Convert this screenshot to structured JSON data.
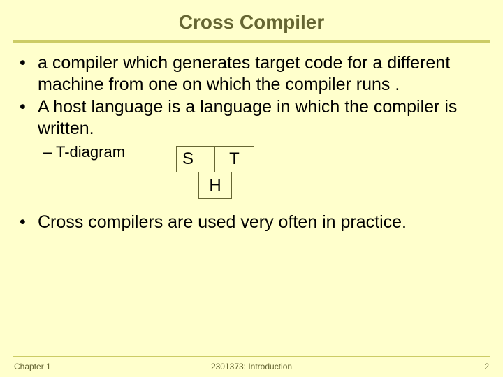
{
  "title": "Cross Compiler",
  "bullets": {
    "b1": "a compiler which generates target code for a different machine from one on which the compiler runs .",
    "b2": "A host language is a language in which the compiler is written.",
    "sub1": "T-diagram",
    "b3": "Cross compilers are used very often in practice."
  },
  "diagram": {
    "s": "S",
    "t": "T",
    "h": "H"
  },
  "footer": {
    "left": "Chapter 1",
    "center": "2301373: Introduction",
    "right": "2"
  }
}
